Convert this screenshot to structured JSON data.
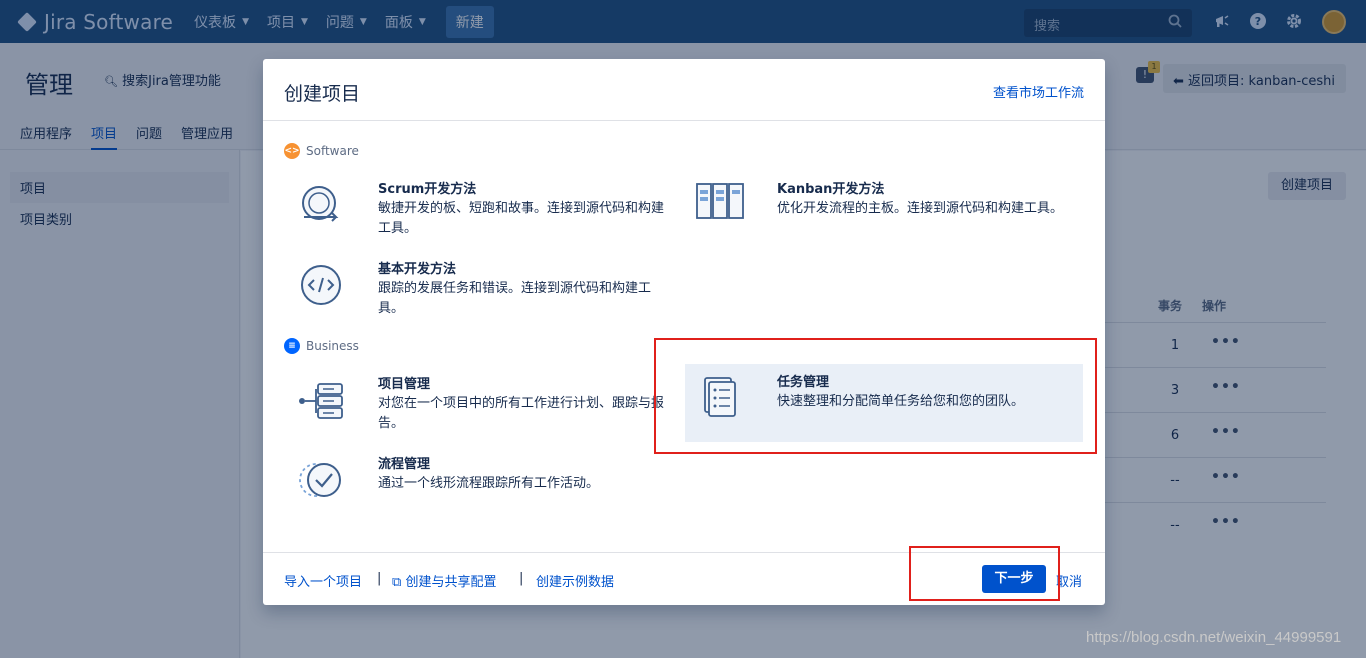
{
  "topnav": {
    "logo_text": "Jira Software",
    "items": [
      {
        "label": "仪表板"
      },
      {
        "label": "项目"
      },
      {
        "label": "问题"
      },
      {
        "label": "面板"
      }
    ],
    "create_label": "新建",
    "search_placeholder": "搜索"
  },
  "admin": {
    "title": "管理",
    "search_label": "搜索Jira管理功能",
    "tabs": [
      "应用程序",
      "项目",
      "问题",
      "管理应用"
    ],
    "active_tab": "项目",
    "return_label": "返回项目: kanban-ceshi",
    "feedback_badge": "1"
  },
  "sidebar": {
    "items": [
      "项目",
      "项目类别"
    ]
  },
  "main": {
    "create_project_label": "创建项目",
    "col_issues": "事务",
    "col_actions": "操作",
    "rows": [
      "1",
      "3",
      "6",
      "--",
      "--"
    ],
    "more_glyph": "•••"
  },
  "dialog": {
    "title": "创建项目",
    "market_link": "查看市场工作流",
    "software_label": "Software",
    "business_label": "Business",
    "templates": {
      "scrum": {
        "name": "Scrum开发方法",
        "desc": "敏捷开发的板、短跑和故事。连接到源代码和构建工具。"
      },
      "kanban": {
        "name": "Kanban开发方法",
        "desc": "优化开发流程的主板。连接到源代码和构建工具。"
      },
      "basic": {
        "name": "基本开发方法",
        "desc": "跟踪的发展任务和错误。连接到源代码和构建工具。"
      },
      "project": {
        "name": "项目管理",
        "desc": "对您在一个项目中的所有工作进行计划、跟踪与报告。"
      },
      "task": {
        "name": "任务管理",
        "desc": "快速整理和分配简单任务给您和您的团队。"
      },
      "process": {
        "name": "流程管理",
        "desc": "通过一个线形流程跟踪所有工作活动。"
      }
    },
    "footer": {
      "import_link": "导入一个项目",
      "share_link": "创建与共享配置",
      "sample_link": "创建示例数据",
      "separator": "|",
      "next_label": "下一步",
      "cancel_label": "取消"
    }
  },
  "watermark": "https://blog.csdn.net/weixin_44999591",
  "colors": {
    "nav_bg": "#205081",
    "primary": "#0052cc",
    "selected_bg": "#e9eff7",
    "annotation_red": "#e0201b",
    "software_icon": "#f79232",
    "business_icon": "#0065ff"
  }
}
